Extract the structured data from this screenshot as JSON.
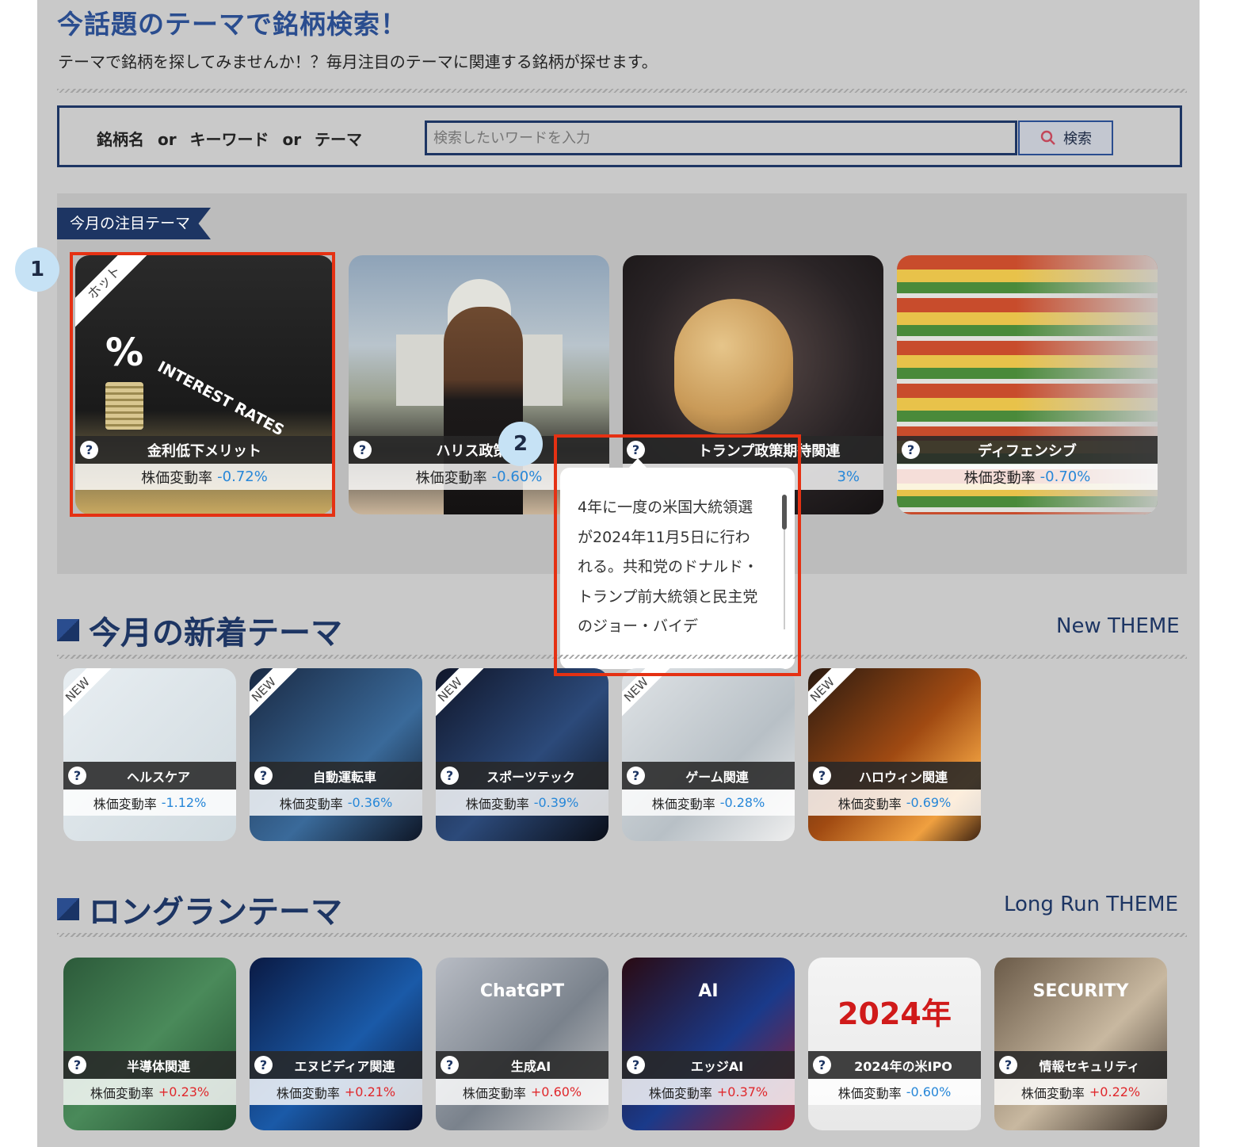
{
  "header": {
    "title": "今話題のテーマで銘柄検索！",
    "subtitle": "テーマで銘柄を探してみませんか！？毎月注目のテーマに関連する銘柄が探せます。"
  },
  "search": {
    "label": "銘柄名 or キーワード or テーマ",
    "placeholder": "検索したいワードを入力",
    "button_label": "検索"
  },
  "hot": {
    "ribbon": "今月の注目テーマ",
    "corner_label": "ホット",
    "rate_label": "株価変動率",
    "cards": [
      {
        "name": "金利低下メリット",
        "rate": "-0.72%",
        "image_text": "INTEREST RATES"
      },
      {
        "name": "ハリス政策期",
        "rate": "-0.60%"
      },
      {
        "name": "トランプ政策期待",
        "suffix": "関連",
        "rate": "3%"
      },
      {
        "name": "ディフェンシブ",
        "rate": "-0.70%"
      }
    ]
  },
  "tooltip": {
    "text": "4年に一度の米国大統領選が2024年11月5日に行われる。共和党のドナルド・トランプ前大統領と民主党のジョー・バイデ"
  },
  "new_section": {
    "title": "今月の新着テーマ",
    "en": "New THEME",
    "corner_label": "NEW",
    "rate_label": "株価変動率",
    "cards": [
      {
        "name": "ヘルスケア",
        "rate": "-1.12%"
      },
      {
        "name": "自動運転車",
        "rate": "-0.36%"
      },
      {
        "name": "スポーツテック",
        "rate": "-0.39%"
      },
      {
        "name": "ゲーム関連",
        "rate": "-0.28%"
      },
      {
        "name": "ハロウィン関連",
        "rate": "-0.69%"
      }
    ]
  },
  "long_section": {
    "title": "ロングランテーマ",
    "en": "Long Run THEME",
    "rate_label": "株価変動率",
    "cards": [
      {
        "name": "半導体関連",
        "rate": "+0.23%"
      },
      {
        "name": "エヌビディア関連",
        "rate": "+0.21%"
      },
      {
        "name": "生成AI",
        "rate": "+0.60%",
        "image_text": "ChatGPT"
      },
      {
        "name": "エッジAI",
        "rate": "+0.37%",
        "image_text": "AI"
      },
      {
        "name": "2024年の米IPO",
        "rate": "-0.60%",
        "image_text": "2024年"
      },
      {
        "name": "情報セキュリティ",
        "rate": "+0.22%",
        "image_text": "SECURITY"
      }
    ]
  },
  "annotations": {
    "badge1": "1",
    "badge2": "2"
  },
  "colors": {
    "accent": "#1d3563",
    "highlight": "#e53113",
    "negative": "#2787d8",
    "positive": "#e0282c"
  }
}
